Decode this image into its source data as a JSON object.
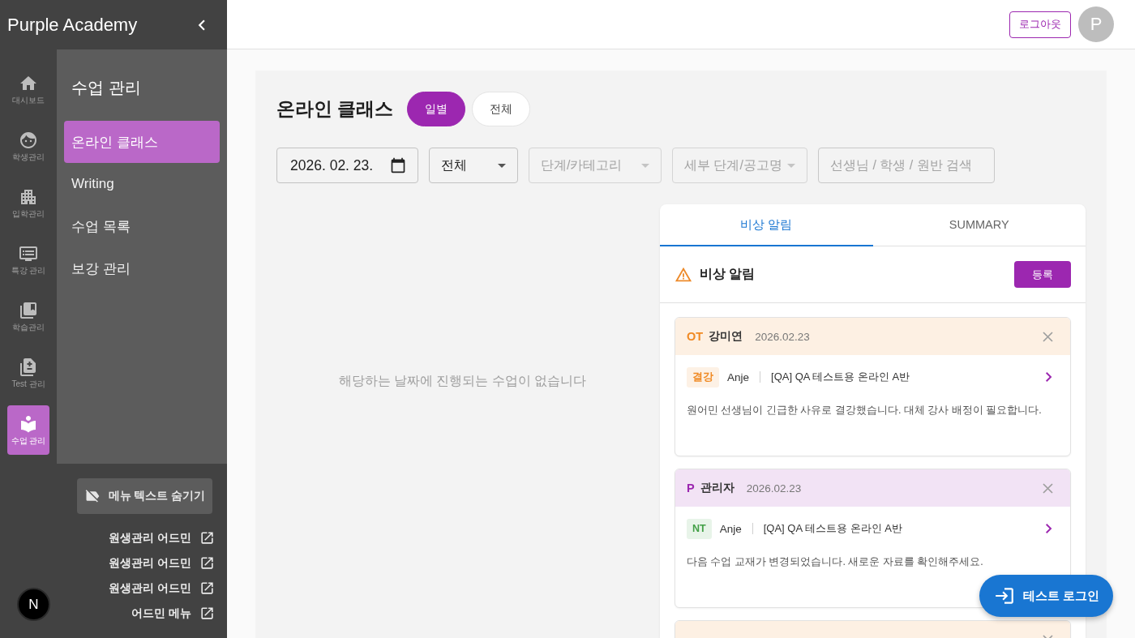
{
  "sidebar": {
    "brand": "Purple Academy",
    "rail": [
      {
        "label": "대시보드",
        "selected": false
      },
      {
        "label": "학생관리",
        "selected": false
      },
      {
        "label": "입학관리",
        "selected": false
      },
      {
        "label": "특강 관리",
        "selected": false
      },
      {
        "label": "학습관리",
        "selected": false
      },
      {
        "label": "Test 관리",
        "selected": false
      },
      {
        "label": "수업 관리",
        "selected": true
      }
    ],
    "submenu": {
      "title": "수업 관리",
      "items": [
        {
          "label": "온라인 클래스",
          "selected": true
        },
        {
          "label": "Writing",
          "selected": false
        },
        {
          "label": "수업 목록",
          "selected": false
        },
        {
          "label": "보강 관리",
          "selected": false
        }
      ]
    },
    "hide_text_button": "메뉴 텍스트 숨기기",
    "external_links": [
      "원생관리 어드민",
      "원생관리 어드민",
      "원생관리 어드민",
      "어드민 메뉴"
    ],
    "dev_badge": "N"
  },
  "header": {
    "logout_button": "로그아웃",
    "avatar": "P"
  },
  "page": {
    "title": "온라인 클래스",
    "view_toggle": [
      {
        "label": "일별",
        "selected": true
      },
      {
        "label": "전체",
        "selected": false
      }
    ],
    "filters": [
      {
        "kind": "date",
        "value": "2026. 02. 23."
      },
      {
        "kind": "select",
        "value": "전체",
        "disabled": false
      },
      {
        "kind": "select",
        "placeholder": "단계/카테고리",
        "disabled": true
      },
      {
        "kind": "select",
        "placeholder": "세부 단계/공고명",
        "disabled": true
      },
      {
        "kind": "search",
        "placeholder": "선생님 / 학생 / 원반 검색"
      }
    ],
    "empty_message": "해당하는 날짜에 진행되는 수업이 없습니다",
    "alert_panel": {
      "tabs": [
        {
          "label": "비상 알림",
          "selected": true
        },
        {
          "label": "SUMMARY",
          "selected": false
        }
      ],
      "title": "비상 알림",
      "register_button": "등록",
      "alerts": [
        {
          "kind": "ot",
          "role": "OT",
          "name": "강미연",
          "date": "2026.02.23",
          "tag": {
            "label": "결강",
            "color": "#f08a24"
          },
          "teacher": "Anje",
          "class_name": "[QA] QA 테스트용 온라인 A반",
          "message": "원어민 선생님이 긴급한 사유로 결강했습니다. 대체 강사 배정이 필요합니다."
        },
        {
          "kind": "admin",
          "role": "P",
          "name": "관리자",
          "date": "2026.02.23",
          "tag": {
            "label": "NT",
            "color": "#43a047"
          },
          "teacher": "Anje",
          "class_name": "[QA] QA 테스트용 온라인 A반",
          "message": "다음 수업 교재가 변경되었습니다. 새로운 자료를 확인해주세요."
        },
        {
          "kind": "ot"
        }
      ]
    }
  },
  "floating_button": "테스트 로그인"
}
